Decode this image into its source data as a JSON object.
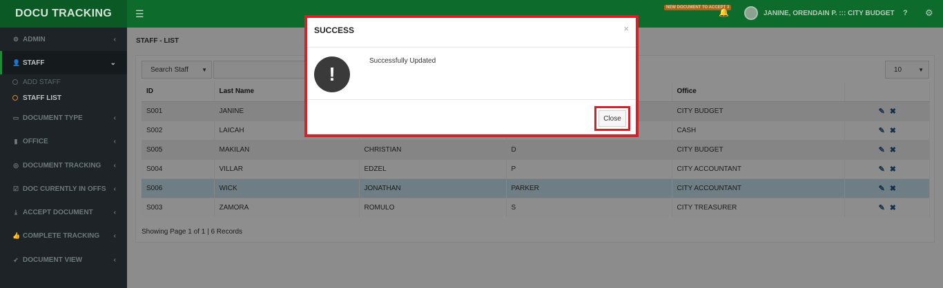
{
  "app": {
    "title": "DOCU TRACKING"
  },
  "header": {
    "notification_badge": "NEW DOCUMENT TO ACCEPT 3",
    "user": "JANINE, ORENDAIN P. ::: CITY BUDGET",
    "help": "?"
  },
  "sidebar": {
    "items": [
      {
        "label": "ADMIN",
        "icon": "gear-icon"
      },
      {
        "label": "STAFF",
        "icon": "user-icon"
      },
      {
        "label": "DOCUMENT TYPE",
        "icon": "folder-icon"
      },
      {
        "label": "OFFICE",
        "icon": "building-icon"
      },
      {
        "label": "DOCUMENT TRACKING",
        "icon": "target-icon"
      },
      {
        "label": "DOC CURENTLY IN OFFS",
        "icon": "check-square-icon"
      },
      {
        "label": "ACCEPT DOCUMENT",
        "icon": "download-icon"
      },
      {
        "label": "COMPLETE TRACKING",
        "icon": "thumbs-up-icon"
      },
      {
        "label": "DOCUMENT VIEW",
        "icon": "rocket-icon"
      }
    ],
    "staff_sub": [
      "ADD STAFF",
      "STAFF LIST"
    ]
  },
  "page": {
    "title": "STAFF - LIST"
  },
  "toolbar": {
    "search_select": "Search Staff",
    "page_length": "10"
  },
  "table": {
    "headers": [
      "ID",
      "Last Name",
      "",
      "",
      "Office",
      ""
    ],
    "rows": [
      [
        "S001",
        "JANINE",
        "",
        "",
        "CITY BUDGET"
      ],
      [
        "S002",
        "LAICAH",
        "",
        "",
        "CASH"
      ],
      [
        "S005",
        "MAKILAN",
        "CHRISTIAN",
        "D",
        "CITY BUDGET"
      ],
      [
        "S004",
        "VILLAR",
        "EDZEL",
        "P",
        "CITY ACCOUNTANT"
      ],
      [
        "S006",
        "WICK",
        "JONATHAN",
        "PARKER",
        "CITY ACCOUNTANT"
      ],
      [
        "S003",
        "ZAMORA",
        "ROMULO",
        "S",
        "CITY TREASURER"
      ]
    ]
  },
  "footer": {
    "info": "Showing Page 1 of 1 | 6 Records"
  },
  "modal": {
    "title": "SUCCESS",
    "close_x": "×",
    "message": "Successfully Updated",
    "icon_glyph": "!",
    "close_label": "Close"
  },
  "colors": {
    "brand_green": "#0d6b2c",
    "highlight_red": "#d2232a",
    "active_dot": "#d08a2a"
  }
}
